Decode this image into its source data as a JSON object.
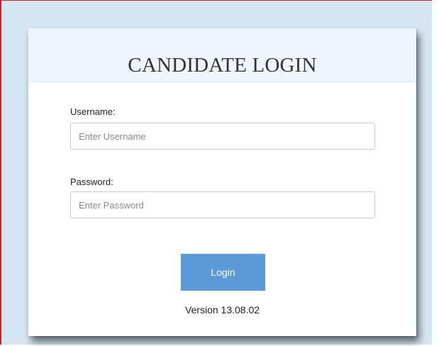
{
  "login_card": {
    "title": "CANDIDATE LOGIN",
    "username": {
      "label": "Username:",
      "placeholder": "Enter Username",
      "value": ""
    },
    "password": {
      "label": "Password:",
      "placeholder": "Enter Password",
      "value": ""
    },
    "login_label": "Login",
    "version": "Version 13.08.02"
  },
  "colors": {
    "page_background": "#d5e6f2",
    "header_background": "#eef5fc",
    "button_background": "#5b99d9",
    "button_text": "#ffffff",
    "frame_border": "#c0282d"
  }
}
